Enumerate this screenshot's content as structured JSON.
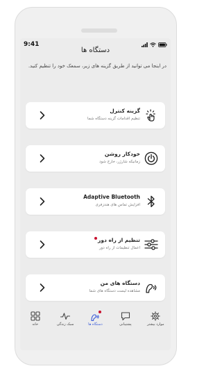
{
  "status_bar": {
    "time": "9:41"
  },
  "header": {
    "title": "دستگاه ها"
  },
  "intro": {
    "text": "در اینجا می توانید از طریق گزینه های زیر، سمعک خود را تنظیم کنید."
  },
  "cards": [
    {
      "title": "گزینه کنترل",
      "subtitle": "تنظیم اقدامات گزینه دستگاه شما",
      "icon": "touch-control-icon",
      "badge": false
    },
    {
      "title": "خودکار روشن",
      "subtitle": "زمانیکه شارژر، خارج شود",
      "icon": "power-icon",
      "badge": false
    },
    {
      "title": "Adaptive Bluetooth",
      "subtitle": "افزایش تماس های هندزفری",
      "icon": "bluetooth-icon",
      "badge": false
    },
    {
      "title": "تنظیم از راه دور",
      "subtitle": "اعمال تنظیمات از راه دور",
      "icon": "sliders-icon",
      "badge": true
    },
    {
      "title": "دستگاه های من",
      "subtitle": "مشاهده لیست دستگاه های شما",
      "icon": "hearing-aid-icon",
      "badge": false
    }
  ],
  "tabs": [
    {
      "label": "خانه",
      "icon": "grid-icon",
      "active": false
    },
    {
      "label": "سبک زندگی",
      "icon": "activity-icon",
      "active": false
    },
    {
      "label": "دستگاه ها",
      "icon": "hearing-aid-tab-icon",
      "active": true,
      "badge": true
    },
    {
      "label": "پشتیبانی",
      "icon": "chat-icon",
      "active": false
    },
    {
      "label": "موارد بیشتر",
      "icon": "gear-icon",
      "active": false
    }
  ],
  "colors": {
    "accent": "#3a5bd9",
    "badge": "#c8102e",
    "card": "#ffffff",
    "background": "#ececec"
  }
}
